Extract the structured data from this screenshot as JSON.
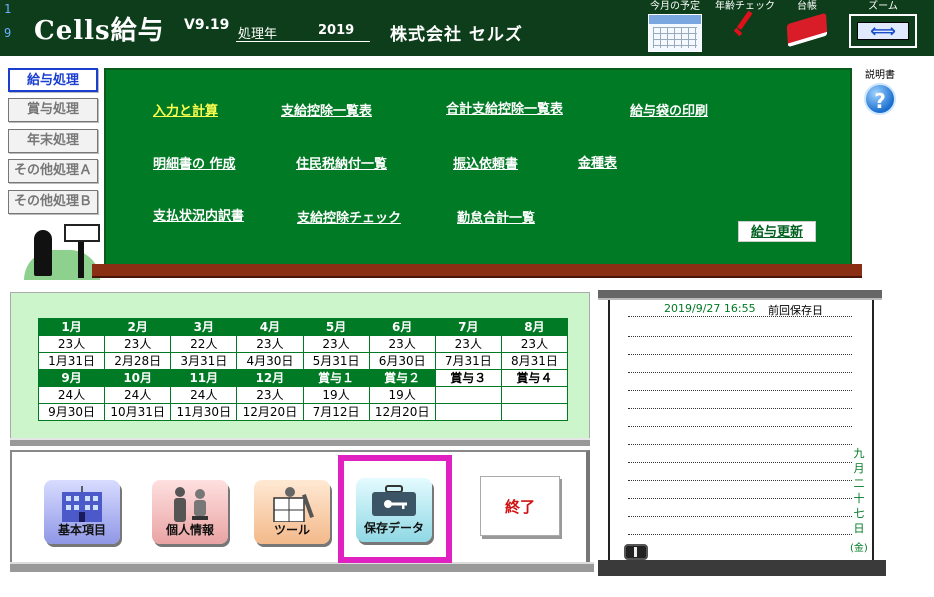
{
  "header": {
    "row1": "1",
    "row2": "9",
    "app_title": "Cells給与",
    "version": "V9.19",
    "year_label": "処理年",
    "year_value": "2019",
    "company": "株式会社 セルズ",
    "buttons": {
      "schedule": "今月の予定",
      "age_check": "年齢チェック",
      "ledger": "台帳",
      "zoom": "ズーム"
    }
  },
  "sidebar": {
    "tabs": [
      {
        "label": "給与処理",
        "active": true
      },
      {
        "label": "賞与処理"
      },
      {
        "label": "年末処理"
      },
      {
        "label": "その他処理Ａ"
      },
      {
        "label": "その他処理Ｂ"
      }
    ]
  },
  "menu": {
    "links": [
      "入力と計算",
      "支給控除一覧表",
      "合計支給控除一覧表",
      "給与袋の印刷",
      "明細書の 作成",
      "住民税納付一覧",
      "振込依頼書",
      "金種表",
      "支払状況内訳書",
      "支給控除チェック",
      "勤怠合計一覧"
    ],
    "update_button": "給与更新"
  },
  "help": {
    "label": "説明書"
  },
  "months": {
    "row1_headers": [
      "1月",
      "2月",
      "3月",
      "4月",
      "5月",
      "6月",
      "7月",
      "8月"
    ],
    "row1_counts": [
      "23人",
      "23人",
      "22人",
      "23人",
      "23人",
      "23人",
      "23人",
      "23人"
    ],
    "row1_dates": [
      "1月31日",
      "2月28日",
      "3月31日",
      "4月30日",
      "5月31日",
      "6月30日",
      "7月31日",
      "8月31日"
    ],
    "row2_headers": [
      "9月",
      "10月",
      "11月",
      "12月",
      "賞与１",
      "賞与２",
      "賞与３",
      "賞与４"
    ],
    "row2_counts": [
      "24人",
      "24人",
      "24人",
      "23人",
      "19人",
      "19人",
      "",
      ""
    ],
    "row2_dates": [
      "9月30日",
      "10月31日",
      "11月30日",
      "12月20日",
      "7月12日",
      "12月20日",
      "",
      ""
    ]
  },
  "tools": {
    "kihon": "基本項目",
    "kojin": "個人情報",
    "tool": "ツール",
    "hozon": "保存データ",
    "end": "終了"
  },
  "notes": {
    "save_date": "2019/9/27 16:55",
    "save_label": "前回保存日",
    "vertical_date": [
      "九",
      "月",
      "二",
      "十",
      "七",
      "日"
    ],
    "weekday": "(金)"
  },
  "colors": {
    "header_bg": "#0d3d1a",
    "board_green": "#007a24",
    "highlight_yellow": "#ffff50",
    "active_tab_blue": "#1a3fd0",
    "selection_magenta": "#e020c0",
    "end_red": "#d01010"
  }
}
